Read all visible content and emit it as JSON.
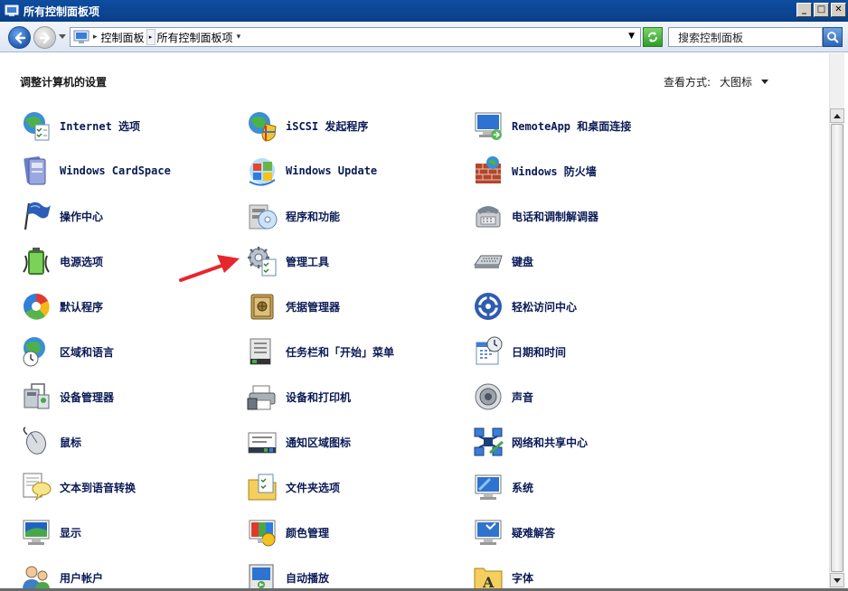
{
  "window": {
    "title": "所有控制面板项",
    "minimize_glyph": "_",
    "maximize_glyph": "□",
    "close_glyph": "✕"
  },
  "address": {
    "breadcrumb": [
      "控制面板",
      "所有控制面板项"
    ],
    "search_placeholder": "搜索控制面板"
  },
  "content": {
    "heading": "调整计算机的设置",
    "view_by_label": "查看方式:",
    "view_by_value": "大图标"
  },
  "items": [
    {
      "label": "Internet 选项",
      "icon": "globe-checklist-icon"
    },
    {
      "label": "iSCSI 发起程序",
      "icon": "globe-shield-icon"
    },
    {
      "label": "RemoteApp 和桌面连接",
      "icon": "remote-desktop-icon"
    },
    {
      "label": "Windows CardSpace",
      "icon": "cardspace-icon"
    },
    {
      "label": "Windows Update",
      "icon": "windows-update-icon"
    },
    {
      "label": "Windows 防火墙",
      "icon": "firewall-icon"
    },
    {
      "label": "操作中心",
      "icon": "flag-icon"
    },
    {
      "label": "程序和功能",
      "icon": "programs-icon"
    },
    {
      "label": "电话和调制解调器",
      "icon": "phone-modem-icon"
    },
    {
      "label": "电源选项",
      "icon": "battery-icon"
    },
    {
      "label": "管理工具",
      "icon": "admin-tools-icon"
    },
    {
      "label": "键盘",
      "icon": "keyboard-icon"
    },
    {
      "label": "默认程序",
      "icon": "default-programs-icon"
    },
    {
      "label": "凭据管理器",
      "icon": "vault-icon"
    },
    {
      "label": "轻松访问中心",
      "icon": "ease-of-access-icon"
    },
    {
      "label": "区域和语言",
      "icon": "globe-clock-icon"
    },
    {
      "label": "任务栏和「开始」菜单",
      "icon": "taskbar-icon"
    },
    {
      "label": "日期和时间",
      "icon": "calendar-clock-icon"
    },
    {
      "label": "设备管理器",
      "icon": "device-manager-icon"
    },
    {
      "label": "设备和打印机",
      "icon": "printer-icon"
    },
    {
      "label": "声音",
      "icon": "speaker-icon"
    },
    {
      "label": "鼠标",
      "icon": "mouse-icon"
    },
    {
      "label": "通知区域图标",
      "icon": "notification-area-icon"
    },
    {
      "label": "网络和共享中心",
      "icon": "network-icon"
    },
    {
      "label": "文本到语音转换",
      "icon": "speech-bubble-icon"
    },
    {
      "label": "文件夹选项",
      "icon": "folder-options-icon"
    },
    {
      "label": "系统",
      "icon": "system-icon"
    },
    {
      "label": "显示",
      "icon": "display-icon"
    },
    {
      "label": "颜色管理",
      "icon": "color-management-icon"
    },
    {
      "label": "疑难解答",
      "icon": "troubleshooting-icon"
    },
    {
      "label": "用户帐户",
      "icon": "user-accounts-icon"
    },
    {
      "label": "自动播放",
      "icon": "autoplay-icon"
    },
    {
      "label": "字体",
      "icon": "fonts-icon"
    }
  ],
  "colors": {
    "titlebar": "#0e4da1",
    "link_text": "#0a1a55",
    "annotation_arrow": "#e8262d"
  }
}
